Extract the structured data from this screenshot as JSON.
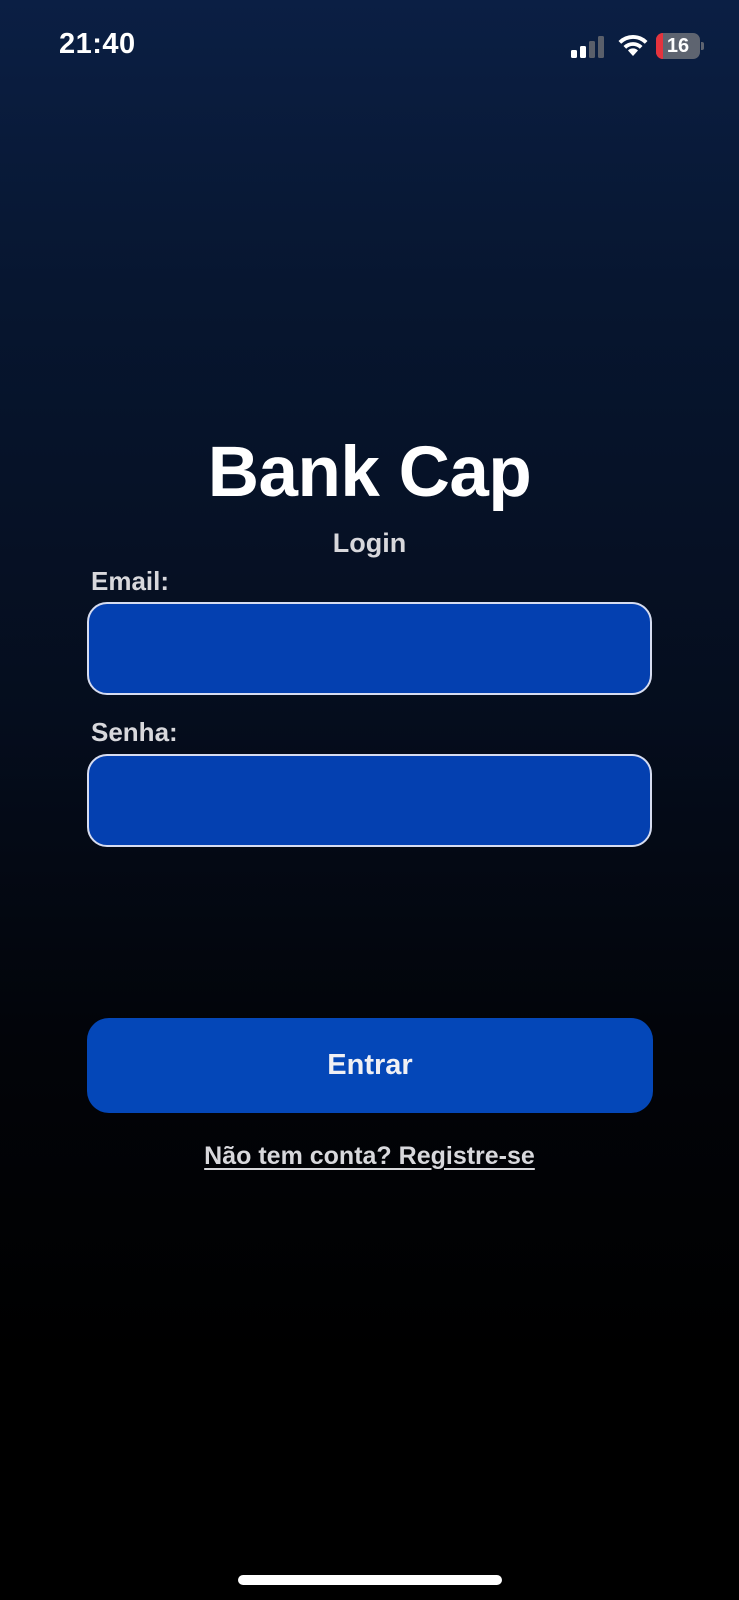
{
  "status_bar": {
    "time": "21:40",
    "battery_level": "16",
    "battery_fraction": 0.16,
    "icons": [
      "signal-icon",
      "wifi-icon",
      "battery-icon"
    ]
  },
  "app": {
    "title": "Bank Cap",
    "subtitle": "Login"
  },
  "form": {
    "email_label": "Email:",
    "email_value": "",
    "password_label": "Senha:",
    "password_value": "",
    "submit_label": "Entrar"
  },
  "register_link": "Não tem conta? Registre-se",
  "colors": {
    "input_background": "#0440b0",
    "button_background": "#0447b8",
    "background_top": "#0b1f44",
    "background_bottom": "#000000",
    "battery_low": "#e5333d"
  }
}
